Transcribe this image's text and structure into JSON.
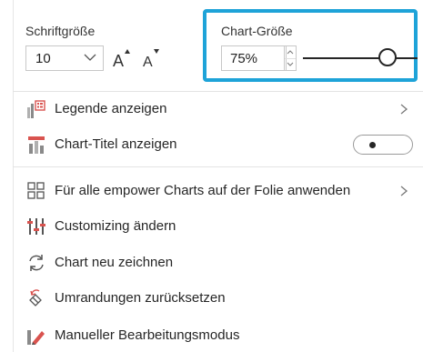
{
  "font_size": {
    "label": "Schriftgröße",
    "value": "10",
    "increase_icon": "font-increase-icon",
    "decrease_icon": "font-decrease-icon"
  },
  "chart_size": {
    "label": "Chart-Größe",
    "value": "75%",
    "slider_fraction": 0.75,
    "highlight_color": "#1ea3d8"
  },
  "menu": {
    "items": [
      {
        "label": "Legende anzeigen",
        "icon": "legend-icon",
        "has_submenu": true
      },
      {
        "label": "Chart-Titel anzeigen",
        "icon": "chart-title-icon",
        "toggle": "off"
      },
      {
        "label": "Für alle empower Charts auf der Folie anwenden",
        "icon": "apply-all-charts-icon",
        "has_submenu": true
      },
      {
        "label": "Customizing ändern",
        "icon": "customizing-icon"
      },
      {
        "label": "Chart neu zeichnen",
        "icon": "redraw-icon"
      },
      {
        "label": "Umrandungen zurücksetzen",
        "icon": "reset-borders-icon"
      },
      {
        "label": "Manueller Bearbeitungsmodus",
        "icon": "manual-edit-icon"
      }
    ]
  },
  "colors": {
    "accent": "#1ea3d8",
    "icon_red": "#d9534f",
    "text": "#262626"
  }
}
